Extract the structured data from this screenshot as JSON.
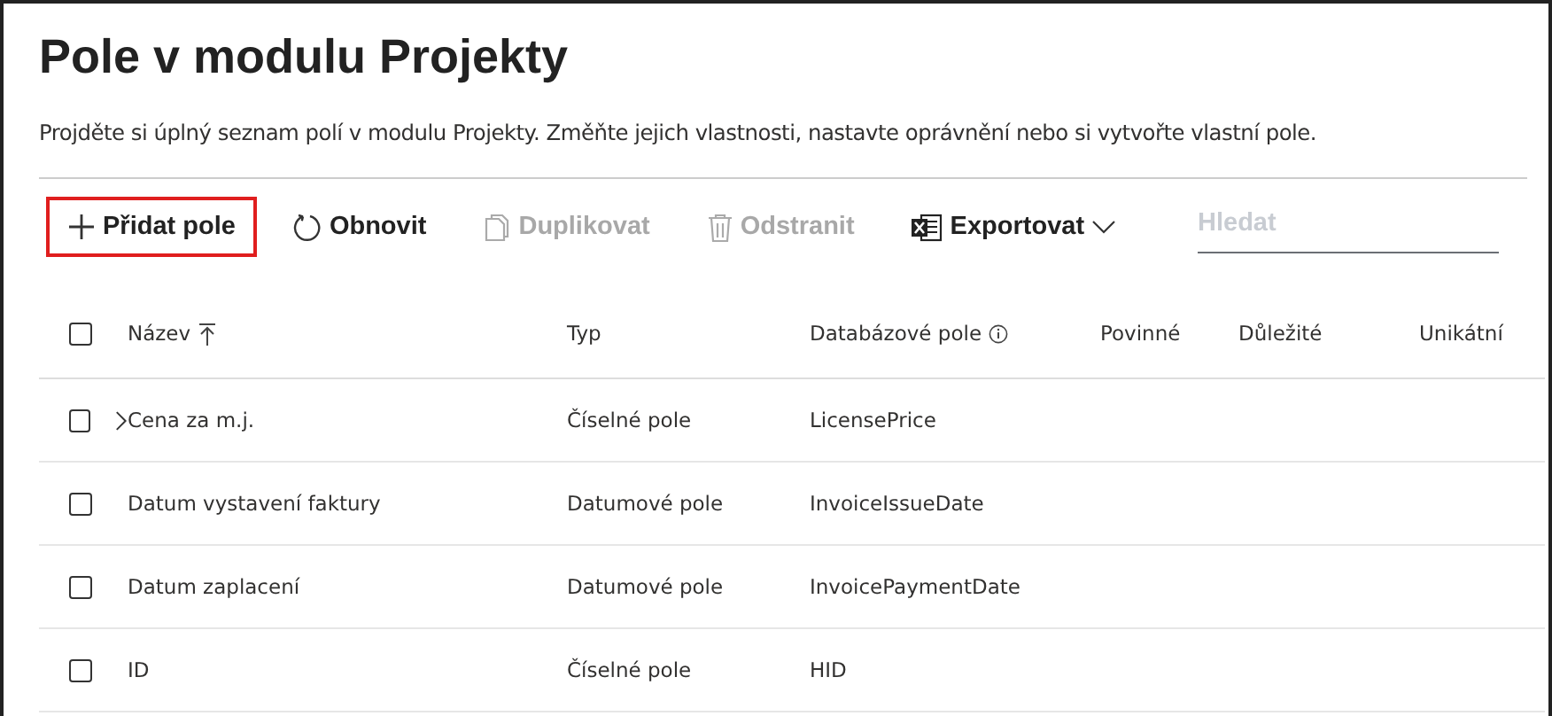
{
  "page": {
    "title": "Pole v modulu Projekty",
    "description": "Projděte si úplný seznam polí v modulu Projekty. Změňte jejich vlastnosti, nastavte oprávnění nebo si vytvořte vlastní pole."
  },
  "toolbar": [
    {
      "kind": "add",
      "label": "Přidat pole",
      "disabled": false,
      "highlighted": true
    },
    {
      "kind": "refresh",
      "label": "Obnovit",
      "disabled": false,
      "highlighted": false
    },
    {
      "kind": "duplicate",
      "label": "Duplikovat",
      "disabled": true,
      "highlighted": false
    },
    {
      "kind": "delete",
      "label": "Odstranit",
      "disabled": true,
      "highlighted": false
    },
    {
      "kind": "export",
      "label": "Exportovat",
      "disabled": false,
      "highlighted": false
    }
  ],
  "search": {
    "placeholder": "Hledat"
  },
  "table": {
    "select_all_checked": false,
    "columns": [
      {
        "label": "Název",
        "sorted": true,
        "info": false
      },
      {
        "label": "Typ",
        "sorted": false,
        "info": false
      },
      {
        "label": "Databázové pole",
        "sorted": false,
        "info": true
      },
      {
        "label": "Povinné",
        "sorted": false,
        "info": false
      },
      {
        "label": "Důležité",
        "sorted": false,
        "info": false
      },
      {
        "label": "Unikátní",
        "sorted": false,
        "info": false
      }
    ],
    "rows": [
      {
        "checked": false,
        "expandable": true,
        "cells": [
          "Cena za m.j.",
          "Číselné pole",
          "LicensePrice"
        ]
      },
      {
        "checked": false,
        "expandable": false,
        "cells": [
          "Datum vystavení faktury",
          "Datumové pole",
          "InvoiceIssueDate"
        ]
      },
      {
        "checked": false,
        "expandable": false,
        "cells": [
          "Datum zaplacení",
          "Datumové pole",
          "InvoicePaymentDate"
        ]
      },
      {
        "checked": false,
        "expandable": false,
        "cells": [
          "ID",
          "Číselné pole",
          "HID"
        ]
      }
    ]
  }
}
